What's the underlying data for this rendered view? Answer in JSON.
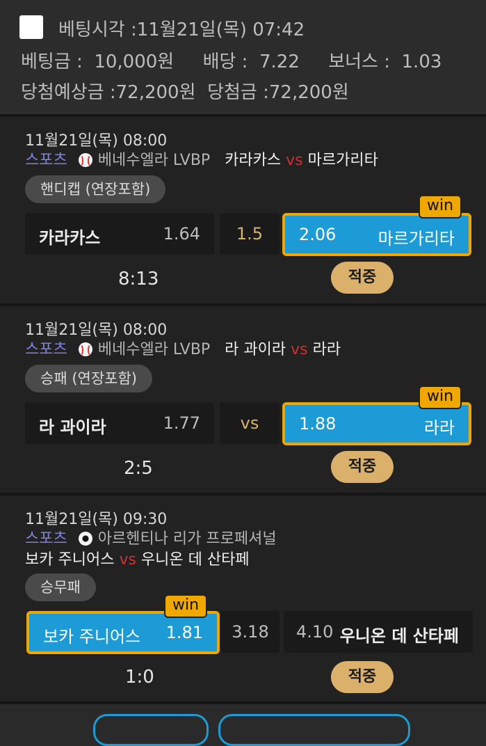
{
  "header": {
    "bet_time_label": "베팅시각 :",
    "bet_time_value": "11월21일(목) 07:42",
    "bet_amount_label": "베팅금 :",
    "bet_amount_value": "10,000원",
    "odds_label": "배당 :",
    "odds_value": "7.22",
    "bonus_label": "보너스 :",
    "bonus_value": "1.03",
    "expected_label": "당첨예상금 :",
    "expected_value": "72,200원",
    "won_label": "당첨금 :",
    "won_value": "72,200원"
  },
  "matches": [
    {
      "datetime": "11월21일(목) 08:00",
      "sport": "스포츠",
      "ball_icon": "baseball-icon",
      "league": "베네수엘라 LVBP",
      "home": "카라카스",
      "vs": "vs",
      "away": "마르가리타",
      "market": "핸디캡 (연장포함)",
      "home_name": "카라카스",
      "home_odds": "1.64",
      "middle": "1.5",
      "away_odds": "2.06",
      "away_name": "마르가리타",
      "win_label": "win",
      "score": "8:13",
      "result": "적중"
    },
    {
      "datetime": "11월21일(목) 08:00",
      "sport": "스포츠",
      "ball_icon": "baseball-icon",
      "league": "베네수엘라 LVBP",
      "home": "라 과이라",
      "vs": "vs",
      "away": "라라",
      "market": "승패 (연장포함)",
      "home_name": "라 과이라",
      "home_odds": "1.77",
      "middle": "vs",
      "away_odds": "1.88",
      "away_name": "라라",
      "win_label": "win",
      "score": "2:5",
      "result": "적중"
    },
    {
      "datetime": "11월21일(목) 09:30",
      "sport": "스포츠",
      "ball_icon": "soccer-ball-icon",
      "league": "아르헨티나 리가 프로페셔널",
      "home": "보카 주니어스",
      "vs": "vs",
      "away": "우니온 데 산타페",
      "market": "승무패",
      "home_name": "보카 주니어스",
      "home_odds": "1.81",
      "middle": "3.18",
      "away_odds": "4.10",
      "away_name": "우니온 데 산타페",
      "win_label": "win",
      "score": "1:0",
      "result": "적중"
    }
  ],
  "colors": {
    "win_fill": "#1c9bd6",
    "win_border": "#f0a800",
    "hit_badge": "#dbb06a",
    "sport_label": "#7f83d8",
    "vs": "#d0302e"
  }
}
